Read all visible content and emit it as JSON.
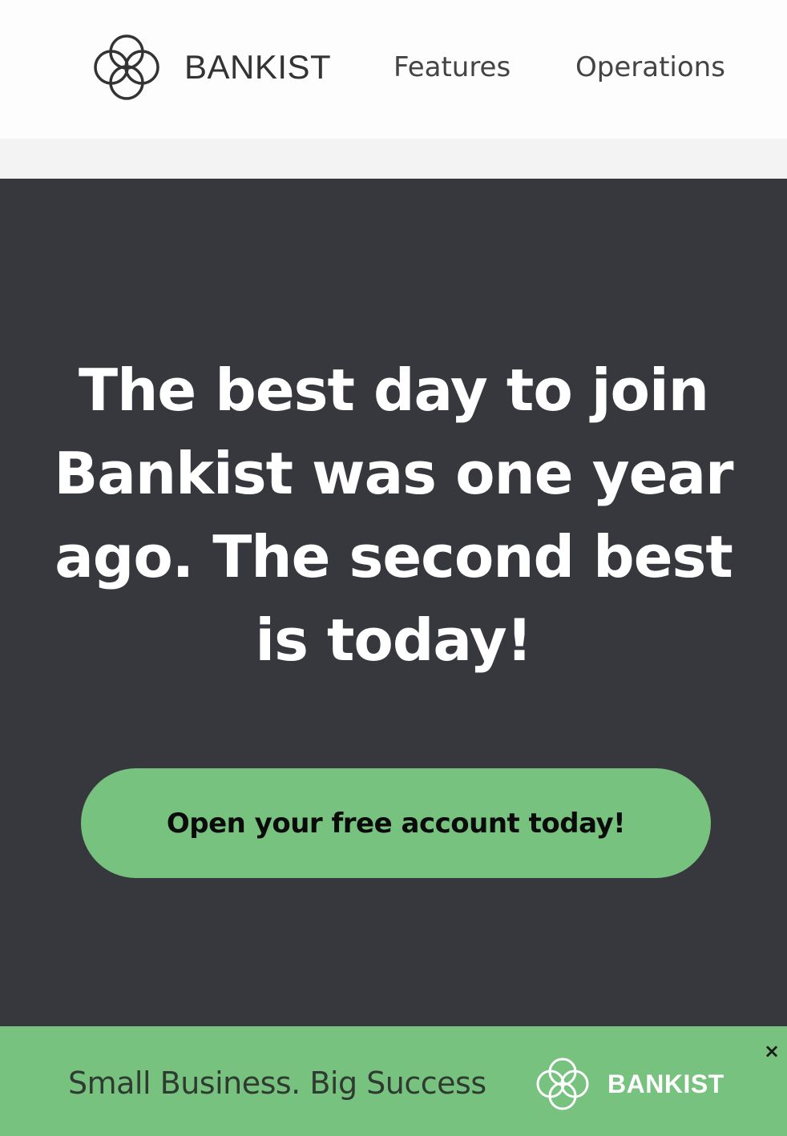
{
  "header": {
    "brand": "BANKIST",
    "logo_icon": "bankist-logo-icon",
    "nav": [
      {
        "label": "Features"
      },
      {
        "label": "Operations"
      }
    ]
  },
  "hero": {
    "heading": "The best day to join Bankist was one year ago. The second best is today!",
    "cta_label": "Open your free account today!"
  },
  "banner": {
    "text": "Small Business. Big Success",
    "brand": "BANKIST",
    "close_label": "×"
  },
  "colors": {
    "hero_background": "#37383d",
    "accent_green": "#78c27f",
    "header_background": "#fdfdfd",
    "brand_text": "#333333"
  }
}
